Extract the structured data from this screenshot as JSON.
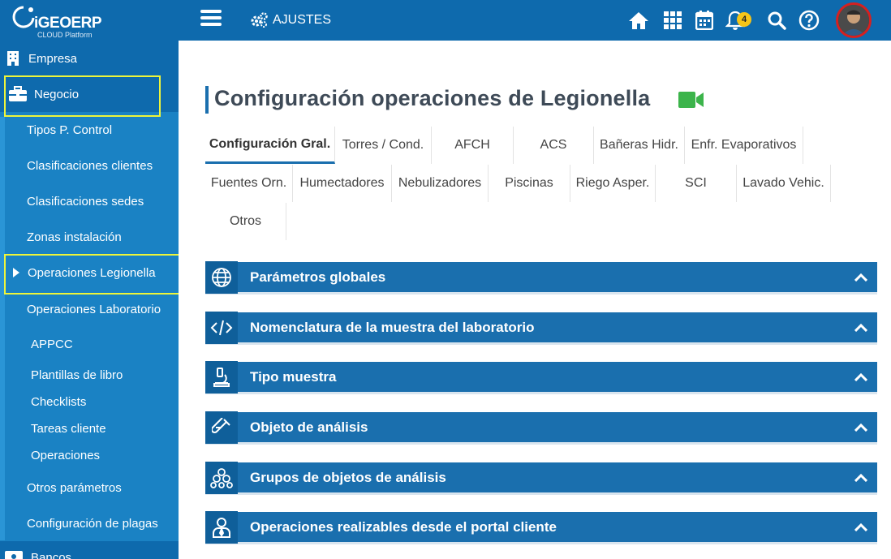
{
  "header": {
    "brand": "iGEOERP",
    "tagline": "CLOUD Platform",
    "crumb": "AJUSTES",
    "notification_count": "4",
    "icons": [
      "home-icon",
      "apps-grid-icon",
      "calendar-icon",
      "bell-icon",
      "search-icon",
      "help-icon"
    ]
  },
  "sidebar": {
    "empresa": "Empresa",
    "negocio": "Negocio",
    "tipos_control": "Tipos P. Control",
    "clasif_clientes": "Clasificaciones clientes",
    "clasif_sedes": "Clasificaciones sedes",
    "zonas": "Zonas instalación",
    "op_legionella": "Operaciones Legionella",
    "op_laboratorio": "Operaciones Laboratorio",
    "appcc": "APPCC",
    "plantillas": "Plantillas de libro",
    "checklists": "Checklists",
    "tareas": "Tareas cliente",
    "operaciones": "Operaciones",
    "otros_param": "Otros parámetros",
    "config_plagas": "Configuración de plagas",
    "bancos": "Bancos"
  },
  "page": {
    "title": "Configuración operaciones de Legionella"
  },
  "tabs": {
    "row1": [
      "Configuración Gral.",
      "Torres / Cond.",
      "AFCH",
      "ACS",
      "Bañeras Hidr.",
      "Enfr. Evaporativos"
    ],
    "row2": [
      "Fuentes Orn.",
      "Humectadores",
      "Nebulizadores",
      "Piscinas",
      "Riego Asper.",
      "SCI",
      "Lavado Vehic."
    ],
    "row3": [
      "Otros"
    ]
  },
  "panels": [
    {
      "title": "Parámetros globales",
      "icon": "globe-icon"
    },
    {
      "title": "Nomenclatura de la muestra del laboratorio",
      "icon": "code-icon"
    },
    {
      "title": "Tipo muestra",
      "icon": "microscope-icon"
    },
    {
      "title": "Objeto de análisis",
      "icon": "test-tube-icon"
    },
    {
      "title": "Grupos de objetos de análisis",
      "icon": "cubes-icon"
    },
    {
      "title": "Operaciones realizables desde el portal cliente",
      "icon": "user-tie-icon"
    }
  ],
  "colors": {
    "topbar": "#0e6aad",
    "sidebar": "#1a82c4",
    "panel": "#1a6fae",
    "highlight": "#eef53a",
    "video": "#3cb44b"
  }
}
